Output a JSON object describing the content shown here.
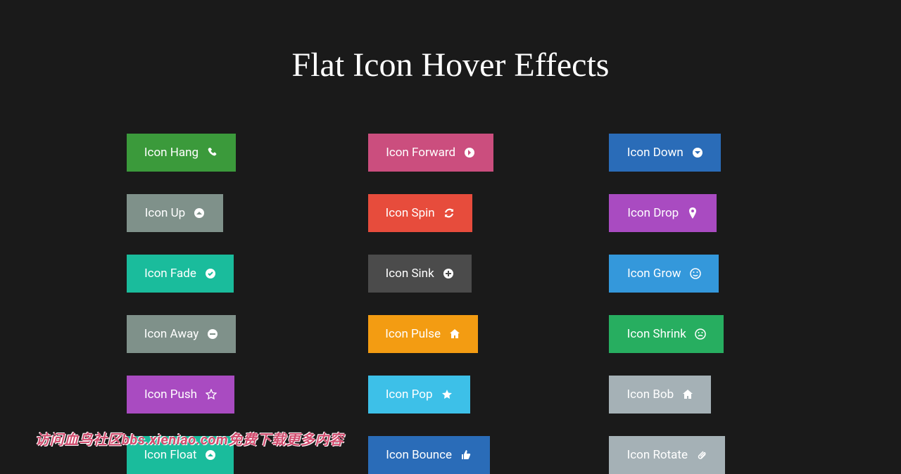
{
  "page": {
    "title": "Flat Icon Hover Effects"
  },
  "buttons": [
    {
      "label": "Icon Hang",
      "color": "#3b9a3b",
      "icon": "phone",
      "width": "w-155"
    },
    {
      "label": "Icon Forward",
      "color": "#cb4e7e",
      "icon": "arrow-right",
      "width": "w-178"
    },
    {
      "label": "Icon Down",
      "color": "#2a6cb8",
      "icon": "arrow-down",
      "width": "w-159"
    },
    {
      "label": "Icon Up",
      "color": "#7f918a",
      "icon": "arrow-up",
      "width": "w-137"
    },
    {
      "label": "Icon Spin",
      "color": "#e74c3c",
      "icon": "refresh",
      "width": "w-148"
    },
    {
      "label": "Icon Drop",
      "color": "#a94bc1",
      "icon": "pin",
      "width": "w-153"
    },
    {
      "label": "Icon Fade",
      "color": "#1abc9c",
      "icon": "check",
      "width": "w-152"
    },
    {
      "label": "Icon Sink",
      "color": "#4b4b4b",
      "icon": "plus",
      "width": "w-147"
    },
    {
      "label": "Icon Grow",
      "color": "#3498db",
      "icon": "smile",
      "width": "w-156"
    },
    {
      "label": "Icon Away",
      "color": "#7f918a",
      "icon": "minus",
      "width": "w-155"
    },
    {
      "label": "Icon Pulse",
      "color": "#f39c12",
      "icon": "home",
      "width": "w-156"
    },
    {
      "label": "Icon Shrink",
      "color": "#27ae60",
      "icon": "frown",
      "width": "w-163"
    },
    {
      "label": "Icon Push",
      "color": "#a94bc1",
      "icon": "star",
      "width": "w-153"
    },
    {
      "label": "Icon Pop",
      "color": "#3dc0e8",
      "icon": "star-fill",
      "width": "w-145"
    },
    {
      "label": "Icon Bob",
      "color": "#a5b1b6",
      "icon": "home",
      "width": "w-145"
    },
    {
      "label": "Icon Float",
      "color": "#1abc9c",
      "icon": "arrow-up",
      "width": "w-152"
    },
    {
      "label": "Icon Bounce",
      "color": "#2a6cb8",
      "icon": "thumbs-up",
      "width": "w-173"
    },
    {
      "label": "Icon Rotate",
      "color": "#a5b1b6",
      "icon": "clip",
      "width": "w-165"
    }
  ],
  "watermark": "访问血鸟社区bbs.xieniao.com免费下载更多内容"
}
